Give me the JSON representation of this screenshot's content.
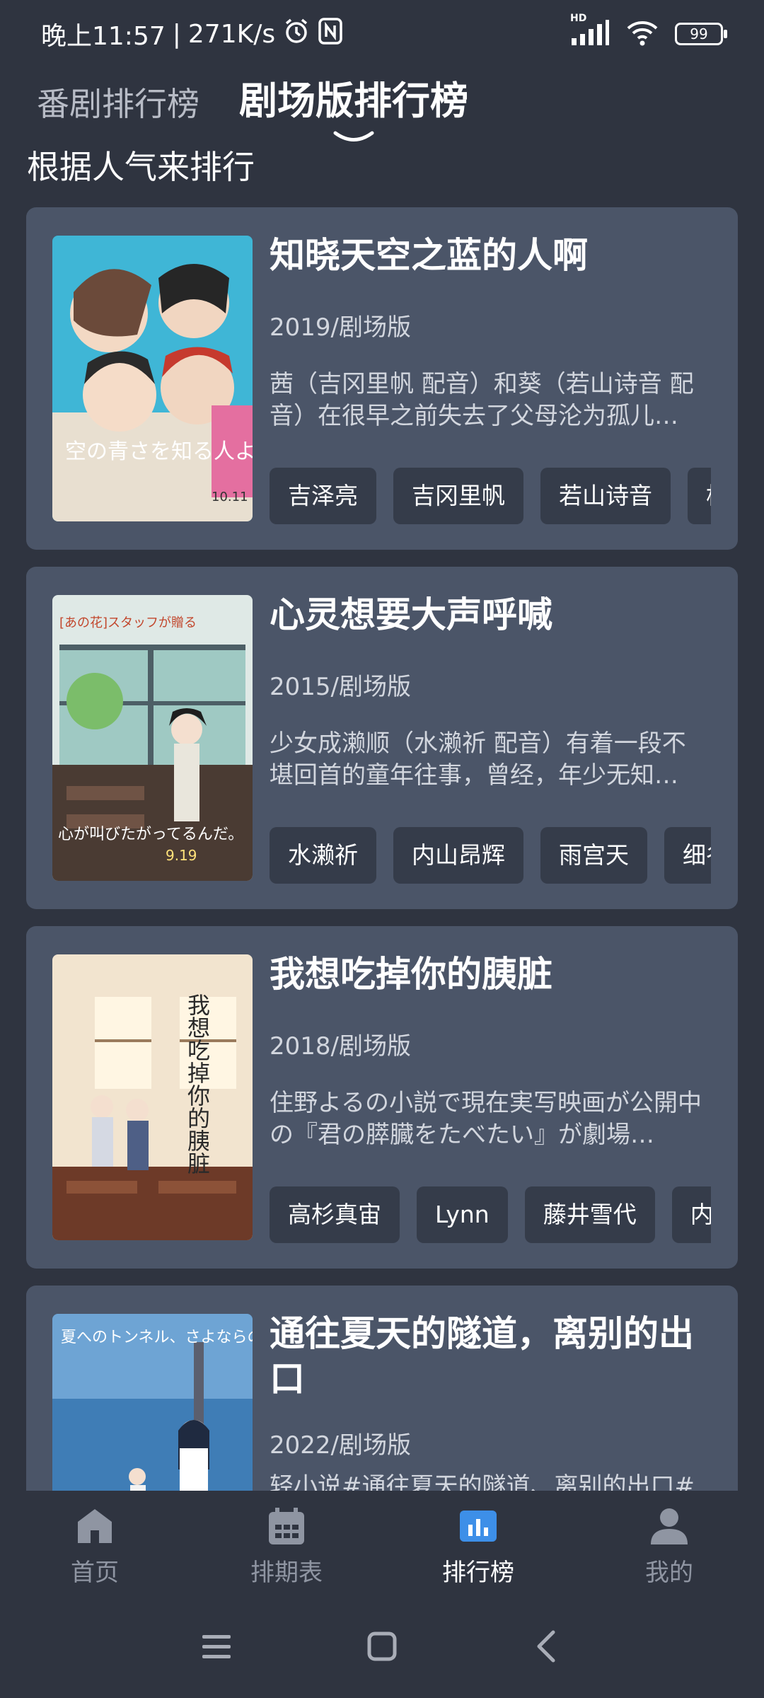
{
  "status": {
    "time": "晚上11:57",
    "speed": "271K/s",
    "network": "HD",
    "battery": "99"
  },
  "tabs": [
    {
      "label": "番剧排行榜",
      "active": false
    },
    {
      "label": "剧场版排行榜",
      "active": true
    }
  ],
  "subtitle": "根据人气来排行",
  "items": [
    {
      "title": "知晓天空之蓝的人啊",
      "meta": "2019/剧场版",
      "desc": "茜（吉冈里帆 配音）和葵（若山诗音 配音）在很早之前失去了父母沦为孤儿…",
      "tags": [
        "吉泽亮",
        "吉冈里帆",
        "若山诗音",
        "松"
      ],
      "poster": {
        "caption": "空の青さを知る人よ",
        "date": "10.11"
      }
    },
    {
      "title": "心灵想要大声呼喊",
      "meta": "2015/剧场版",
      "desc": "少女成濑顺（水濑祈 配音）有着一段不堪回首的童年往事，曾经，年少无知…",
      "tags": [
        "水濑祈",
        "内山昂辉",
        "雨宫天",
        "细谷"
      ],
      "poster": {
        "caption": "心が叫びたがってるんだ。",
        "date": "9.19"
      }
    },
    {
      "title": "我想吃掉你的胰脏",
      "meta": "2018/剧场版",
      "desc": "住野よるの小説で現在実写映画が公開中の『君の膵臓をたべたい』が劇場…",
      "tags": [
        "高杉真宙",
        "Lynn",
        "藤井雪代",
        "内田"
      ],
      "poster": {
        "caption": "我想吃掉你的胰脏",
        "date": ""
      }
    },
    {
      "title": "通往夏天的隧道，离别的出口",
      "meta": "2022/剧场版",
      "desc": "轻小说#通往夏天的隧道、离别的出口#",
      "tags": [],
      "poster": {
        "caption": "夏へのトンネル、さよならの出口",
        "date": ""
      }
    }
  ],
  "nav": [
    {
      "label": "首页",
      "icon": "home-icon",
      "active": false
    },
    {
      "label": "排期表",
      "icon": "calendar-icon",
      "active": false
    },
    {
      "label": "排行榜",
      "icon": "bar-chart-icon",
      "active": true
    },
    {
      "label": "我的",
      "icon": "user-icon",
      "active": false
    }
  ],
  "colors": {
    "background": "#2f3440",
    "card": "#4b5568",
    "tag": "#353c4a",
    "accent": "#3d8fe8"
  }
}
